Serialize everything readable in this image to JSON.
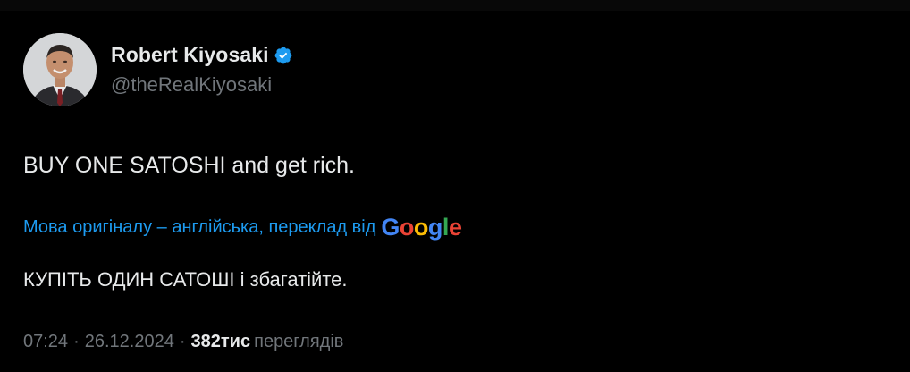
{
  "author": {
    "display_name": "Robert Kiyosaki",
    "handle": "@theRealKiyosaki",
    "verified": true
  },
  "tweet": {
    "text": "BUY ONE SATOSHI and get rich."
  },
  "translation": {
    "link_text": "Мова оригіналу – англійська, переклад від",
    "provider_logo": [
      "G",
      "o",
      "o",
      "g",
      "l",
      "e"
    ],
    "provider_colors": [
      "#4285F4",
      "#EA4335",
      "#FBBC05",
      "#4285F4",
      "#34A853",
      "#EA4335"
    ],
    "translated_text": "КУПІТЬ ОДИН САТОШІ і збагатійте."
  },
  "meta": {
    "time": "07:24",
    "separator": "·",
    "date": "26.12.2024",
    "views_count": "382тис",
    "views_label": "переглядів"
  },
  "colors": {
    "background": "#000000",
    "text_primary": "#e7e9ea",
    "text_secondary": "#71767b",
    "link": "#1d9bf0",
    "verified_badge": "#1d9bf0"
  },
  "icons": {
    "verified": "verified-badge-icon"
  }
}
